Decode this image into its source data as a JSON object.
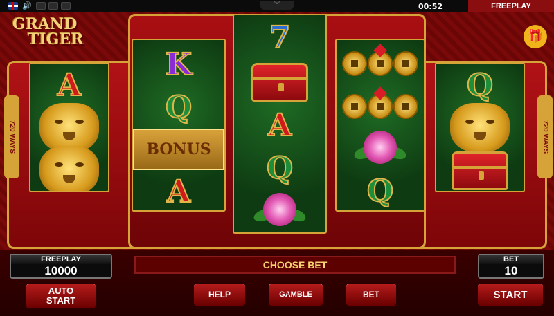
{
  "topbar": {
    "language_icon": "uk-flag-icon",
    "sound_icon": "speaker-icon",
    "clock": "00:52",
    "mode": "FREEPLAY"
  },
  "game": {
    "logo_line1": "GRAND",
    "logo_line2": "TIGER",
    "ways_label": "720 WAYS"
  },
  "reels": [
    [
      "A",
      "tiger",
      "tiger"
    ],
    [
      "K",
      "Q",
      "BONUS",
      "A"
    ],
    [
      "7",
      "chest",
      "A",
      "Q",
      "peony"
    ],
    [
      "coins",
      "coins",
      "peony",
      "Q"
    ],
    [
      "Q",
      "tiger",
      "chest"
    ]
  ],
  "bonus_label": "BONUS",
  "panel": {
    "balance_label": "FREEPLAY",
    "balance_value": "10000",
    "message": "CHOOSE BET",
    "bet_label": "BET",
    "bet_value": "10"
  },
  "buttons": {
    "auto_start_line1": "AUTO",
    "auto_start_line2": "START",
    "help": "HELP",
    "gamble": "GAMBLE",
    "bet": "BET",
    "start": "START"
  },
  "colors": {
    "accent_gold": "#d6a339",
    "background_red": "#7a0909",
    "reel_green": "#0e3b12"
  }
}
